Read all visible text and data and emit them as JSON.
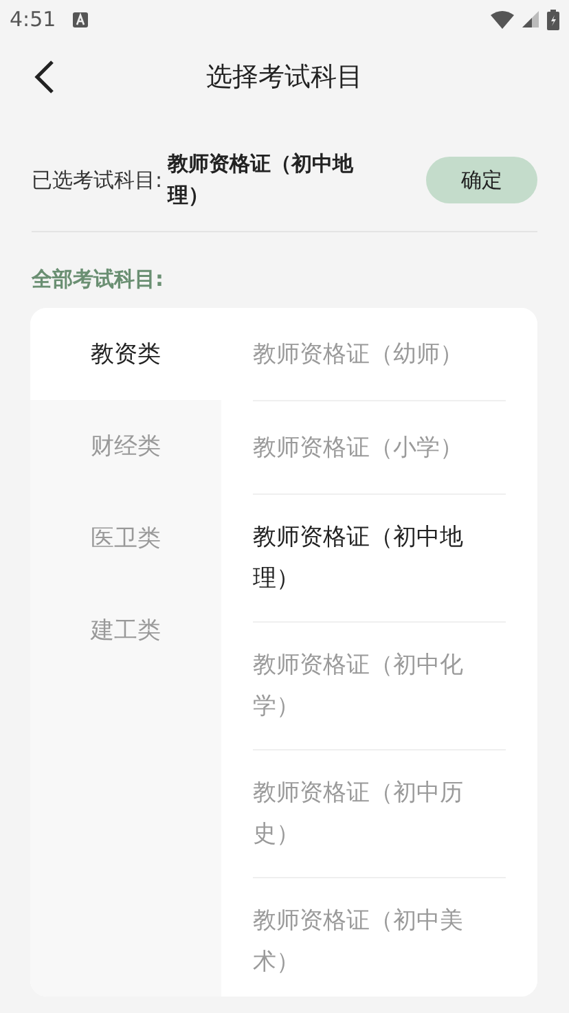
{
  "status_bar": {
    "time": "4:51"
  },
  "header": {
    "title": "选择考试科目"
  },
  "selected_subject": {
    "label": "已选考试科目:",
    "value": "教师资格证（初中地理）",
    "confirm_button": "确定"
  },
  "section_title": "全部考试科目:",
  "categories": [
    {
      "label": "教资类",
      "selected": true
    },
    {
      "label": "财经类",
      "selected": false
    },
    {
      "label": "医卫类",
      "selected": false
    },
    {
      "label": "建工类",
      "selected": false
    }
  ],
  "subjects": [
    {
      "label": "教师资格证（幼师）",
      "selected": false
    },
    {
      "label": "教师资格证（小学）",
      "selected": false
    },
    {
      "label": "教师资格证（初中地理）",
      "selected": true
    },
    {
      "label": "教师资格证（初中化学）",
      "selected": false
    },
    {
      "label": "教师资格证（初中历史）",
      "selected": false
    },
    {
      "label": "教师资格证（初中美术）",
      "selected": false
    }
  ]
}
